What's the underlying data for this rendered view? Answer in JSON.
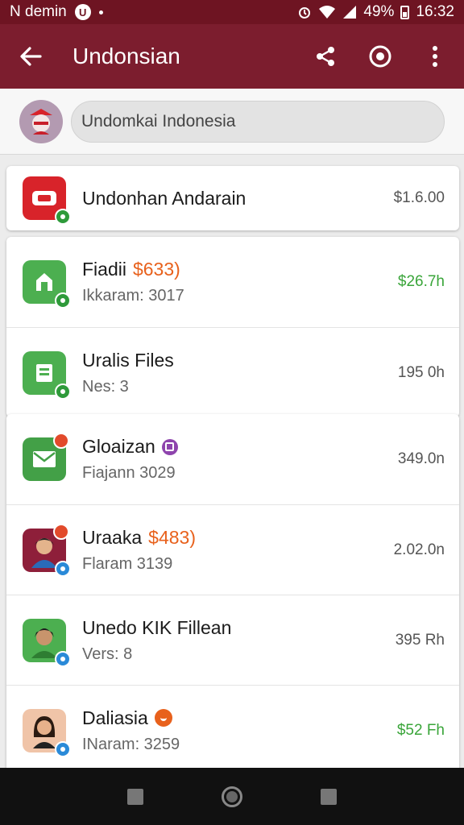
{
  "status_bar": {
    "carrier": "N demin",
    "battery": "49%",
    "time": "16:32"
  },
  "app_bar": {
    "title": "Undonsian"
  },
  "search": {
    "value": "Undomkai Indonesia"
  },
  "colors": {
    "app_bar": "#7c1d2e",
    "status_bar": "#6e1422",
    "positive_amount": "#3aa53a",
    "tag_orange": "#e8611c"
  },
  "featured": {
    "name": "Undonhan Andarain",
    "amount": "$1.6.00",
    "icon": "youtube-icon"
  },
  "group1": [
    {
      "name": "Fiadii",
      "tag": "$633)",
      "sub": "Ikkaram: 3017",
      "amount": "$26.7h",
      "amount_color": "green",
      "icon": "home-icon"
    },
    {
      "name": "Uralis Files",
      "sub": "Nes: 3",
      "amount": "195 0h",
      "amount_color": "gray",
      "icon": "files-icon"
    }
  ],
  "group2": [
    {
      "name": "Gloaizan",
      "sub": "Fiajann 3029",
      "amount": "349.0n",
      "amount_color": "gray",
      "icon": "mail-icon"
    },
    {
      "name": "Uraaka",
      "tag": "$483)",
      "sub": "Flaram 3139",
      "amount": "2.02.0n",
      "amount_color": "gray",
      "icon": "person-icon"
    },
    {
      "name": "Unedo KIK Fillean",
      "sub": "Vers: 8",
      "amount": "395 Rh",
      "amount_color": "gray",
      "icon": "person-icon"
    },
    {
      "name": "Daliasia",
      "sub": "INaram: 3259",
      "amount": "$52 Fh",
      "amount_color": "green",
      "icon": "person-icon"
    }
  ]
}
